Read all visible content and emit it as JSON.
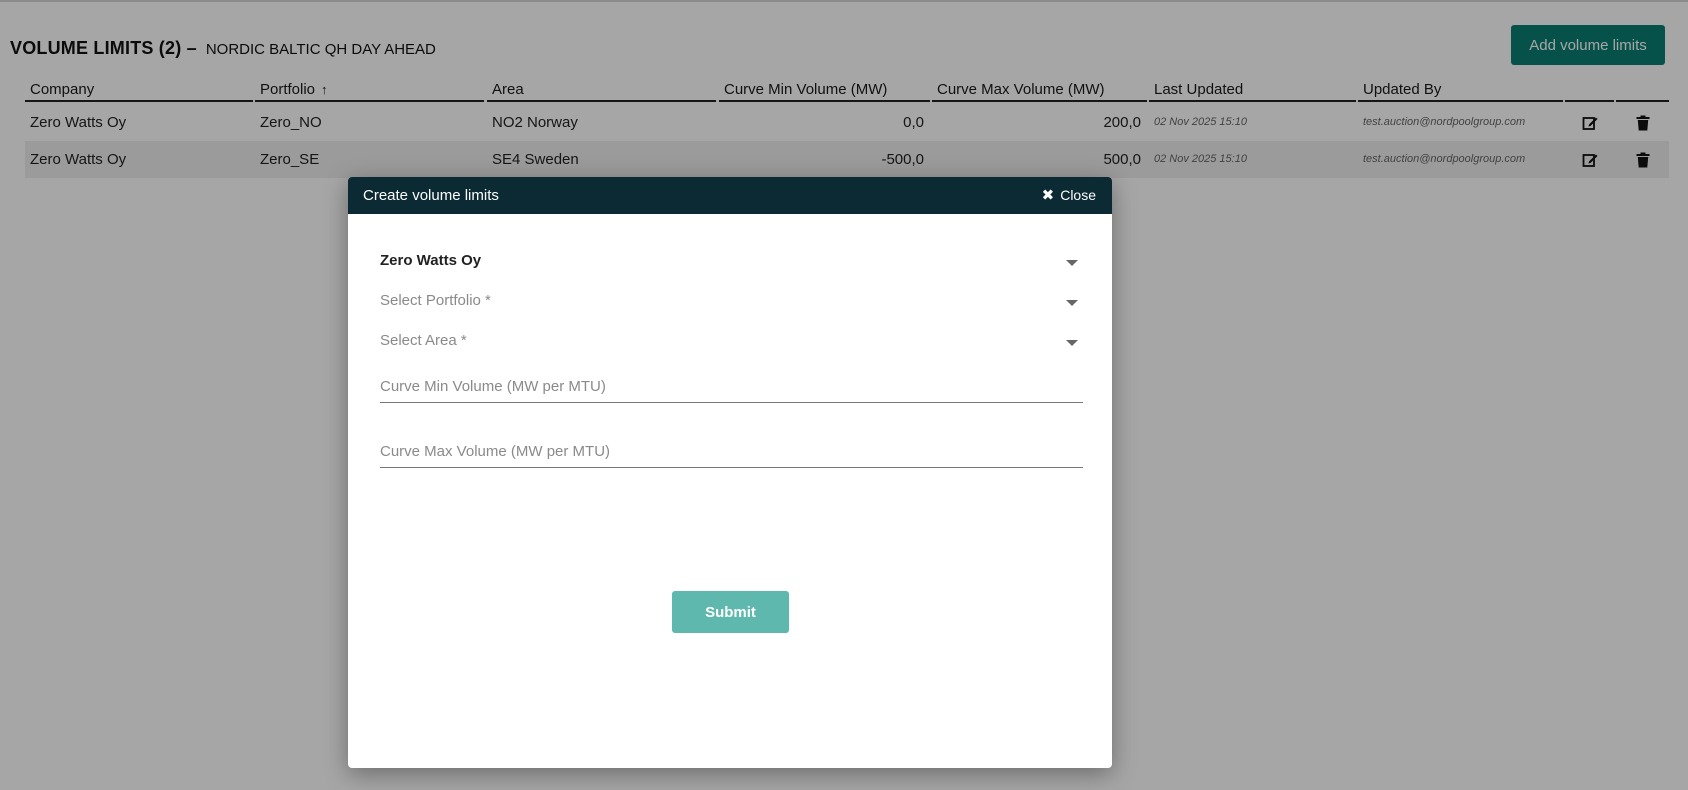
{
  "header": {
    "title": "VOLUME LIMITS (2) –",
    "subtitle": "NORDIC BALTIC QH DAY AHEAD",
    "add_button_label": "Add volume limits"
  },
  "table": {
    "columns": [
      "Company",
      "Portfolio",
      "Area",
      "Curve Min Volume (MW)",
      "Curve Max Volume (MW)",
      "Last Updated",
      "Updated By"
    ],
    "sort_indicator": "↑",
    "rows": [
      {
        "company": "Zero Watts Oy",
        "portfolio": "Zero_NO",
        "area": "NO2 Norway",
        "min": "0,0",
        "max": "200,0",
        "updated": "02 Nov 2025 15:10",
        "by": "test.auction@nordpoolgroup.com"
      },
      {
        "company": "Zero Watts Oy",
        "portfolio": "Zero_SE",
        "area": "SE4 Sweden",
        "min": "-500,0",
        "max": "500,0",
        "updated": "02 Nov 2025 15:10",
        "by": "test.auction@nordpoolgroup.com"
      }
    ],
    "row_icons": [
      "edit-icon",
      "trash-icon"
    ]
  },
  "modal": {
    "title": "Create volume limits",
    "close_label": "Close",
    "close_icon": "close-icon",
    "company_value": "Zero Watts Oy",
    "portfolio_placeholder": "Select Portfolio *",
    "area_placeholder": "Select Area *",
    "min_placeholder": "Curve Min Volume (MW per MTU)",
    "max_placeholder": "Curve Max Volume (MW per MTU)",
    "submit_label": "Submit"
  },
  "colors": {
    "accent": "#0a7f73",
    "modal_header": "#0b2a33",
    "submit": "#5fb8ad"
  }
}
